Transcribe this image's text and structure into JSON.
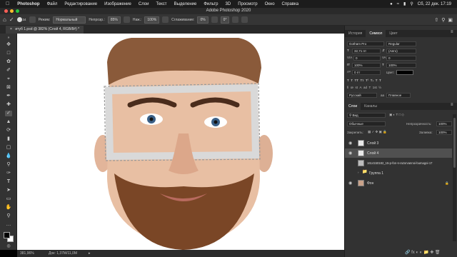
{
  "menubar": {
    "app": "Photoshop",
    "items": [
      "Файл",
      "Редактирование",
      "Изображение",
      "Слои",
      "Текст",
      "Выделение",
      "Фильтр",
      "3D",
      "Просмотр",
      "Окно",
      "Справка"
    ],
    "clock": "Сб, 22 дек.  17:19"
  },
  "window": {
    "title": "Adobe Photoshop 2020"
  },
  "options": {
    "brush_size": "34",
    "mode_label": "Режим:",
    "mode_value": "Нормальный",
    "opacity_label": "Непрозр.:",
    "opacity_value": "85%",
    "flow_label": "Наж.:",
    "flow_value": "100%",
    "smoothing_label": "Сглаживание:",
    "smoothing_value": "0%",
    "angle_value": "0°"
  },
  "document": {
    "tab_label": "итуб 1.psd @ 382% (Слой 4, RGB/8#) *"
  },
  "status": {
    "zoom": "381,96%",
    "doc": "Док: 1,37М/11,0М"
  },
  "colors": {
    "menubar": "#1c1c1c",
    "panel": "#323232",
    "selected_layer": "#505050"
  },
  "char_panel": {
    "tabs": [
      "История",
      "Символ",
      "Цвет"
    ],
    "font_family": "Gotham Pro",
    "font_style": "Regular",
    "font_size": "32,71 пт",
    "leading": "(Авто)",
    "kerning": "0",
    "tracking": "0",
    "vscale": "100%",
    "hscale": "100%",
    "baseline": "0 пт",
    "color_label": "Цвет:",
    "language": "Русский",
    "antialias": "Плавное"
  },
  "layers_panel": {
    "tabs": [
      "Слои",
      "Каналы"
    ],
    "filter": "Вид",
    "blend_mode": "Обычные",
    "opacity_label": "Непрозрачность:",
    "opacity_value": "100%",
    "lock_label": "Закрепить:",
    "fill_label": "Заливка:",
    "fill_value": "100%",
    "layers": [
      {
        "name": "Слой 3",
        "selected": false
      },
      {
        "name": "Слой 4",
        "selected": true
      },
      {
        "name": "1614150182_15-p-fon-s-razorvannoi-bumagoi-17",
        "selected": false
      },
      {
        "name": "Группа 1",
        "selected": false
      },
      {
        "name": "Фон",
        "selected": false
      }
    ]
  }
}
